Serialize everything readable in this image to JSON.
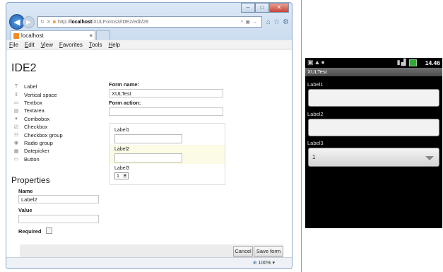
{
  "browser": {
    "url_prefix": "http://",
    "url_host": "localhost",
    "url_path": "/XULForms3/IDE2/edit/28",
    "tab_title": "localhost",
    "menu": [
      "File",
      "Edit",
      "View",
      "Favorites",
      "Tools",
      "Help"
    ],
    "zoom": "100%",
    "window_buttons": {
      "minimize": "–",
      "maximize": "□",
      "close": "✕"
    }
  },
  "ide": {
    "title": "IDE2",
    "palette": [
      {
        "label": "Label",
        "icon": "label-icon",
        "glyph": "T"
      },
      {
        "label": "Vertical space",
        "icon": "vertical-space-icon",
        "glyph": "⇕"
      },
      {
        "label": "Textbox",
        "icon": "textbox-icon",
        "glyph": "▭"
      },
      {
        "label": "Textarea",
        "icon": "textarea-icon",
        "glyph": "▤"
      },
      {
        "label": "Combobox",
        "icon": "combobox-icon",
        "glyph": "▾"
      },
      {
        "label": "Checkbox",
        "icon": "checkbox-icon",
        "glyph": "☑"
      },
      {
        "label": "Checkbox group",
        "icon": "checkbox-group-icon",
        "glyph": "☷"
      },
      {
        "label": "Radio group",
        "icon": "radio-group-icon",
        "glyph": "◉"
      },
      {
        "label": "Datepicker",
        "icon": "datepicker-icon",
        "glyph": "▦"
      },
      {
        "label": "Button",
        "icon": "button-icon",
        "glyph": "▭"
      }
    ],
    "form_name_label": "Form name:",
    "form_name_value": "XULTest",
    "form_action_label": "Form action:",
    "form_action_value": "",
    "canvas": {
      "label1": "Label1",
      "label2": "Label2",
      "label3": "Label3",
      "select_value": "1"
    },
    "properties_title": "Properties",
    "name_label": "Name",
    "name_value": "Label2",
    "value_label": "Value",
    "value_value": "",
    "required_label": "Required",
    "cancel_label": "Cancel",
    "save_label": "Save form"
  },
  "android": {
    "status_time": "14.46",
    "app_title": "XULTest",
    "label1": "Label1",
    "label2": "Label2",
    "label3": "Label3",
    "spinner_value": "1"
  }
}
